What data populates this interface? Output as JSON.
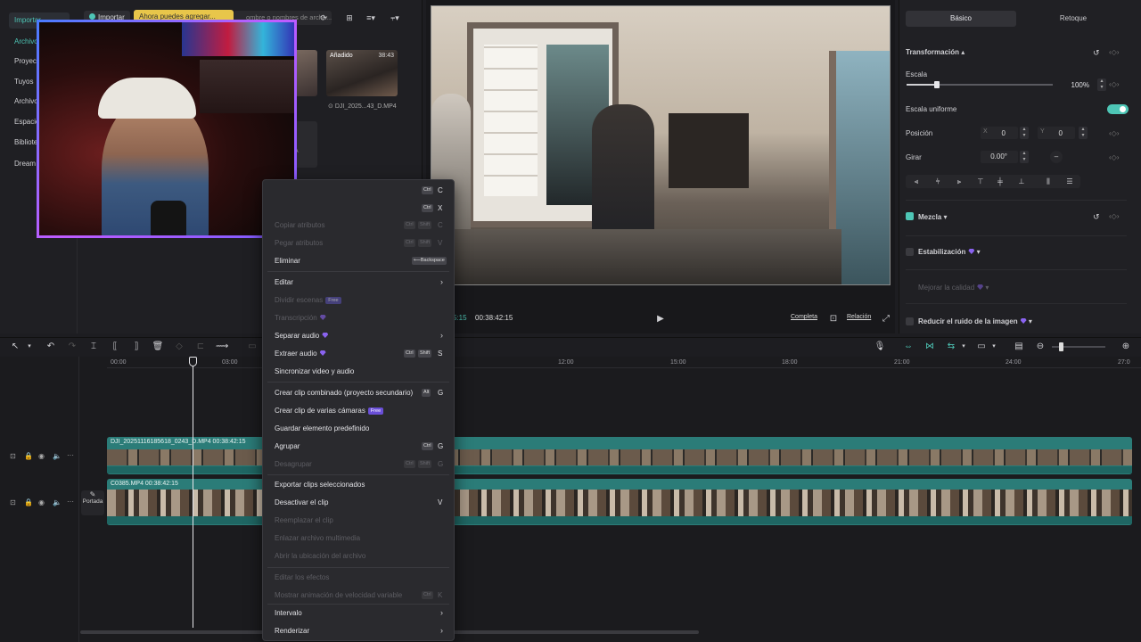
{
  "left_panel": {
    "sidebar": [
      "Importar",
      "Archivos",
      "Proyecto",
      "Tuyos",
      "Archivo",
      "Espacio",
      "Biblioteca",
      "Dream"
    ],
    "import_button": "Importar",
    "tooltip": "Ahora puedes agregar...",
    "search_placeholder": "ombre o nombres de archiv...",
    "media": [
      {
        "badge": "Añadido",
        "duration": "38:43",
        "name": "DJI_2025...43_D.MP4"
      }
    ],
    "partial_label": "A"
  },
  "preview": {
    "time_partial": "5:15",
    "timecode": "00:38:42:15",
    "quality": "Completa",
    "ratio": "Relación"
  },
  "props": {
    "tabs": [
      "Básico",
      "Retoque"
    ],
    "transform": "Transformación",
    "scale_label": "Escala",
    "scale_value": "100%",
    "uniform_label": "Escala uniforme",
    "position_label": "Posición",
    "pos_x_label": "X",
    "pos_x": "0",
    "pos_y_label": "Y",
    "pos_y": "0",
    "rotate_label": "Girar",
    "rotate_value": "0.00°",
    "blend_label": "Mezcla",
    "stabilize_label": "Estabilización",
    "quality_label": "Mejorar la calidad",
    "denoise_label": "Reducir el ruido de la imagen"
  },
  "timeline": {
    "ticks": [
      "00:00",
      "03:00",
      "12:00",
      "15:00",
      "18:00",
      "21:00",
      "24:00",
      "27:0"
    ],
    "clip1_title": "DJI_20251116185618_0243_D.MP4   00:38:42:15",
    "clip2_title": "C0385.MP4   00:38:42:15",
    "cover_label": "Portada"
  },
  "context_menu": {
    "items": [
      {
        "label": "",
        "keys": [
          "Ctrl"
        ],
        "letter": "C",
        "disabled": false
      },
      {
        "label": "",
        "keys": [
          "Ctrl"
        ],
        "letter": "X",
        "disabled": false
      },
      {
        "label": "Copiar atributos",
        "keys": [
          "Ctrl",
          "Shift"
        ],
        "letter": "C",
        "disabled": true
      },
      {
        "label": "Pegar atributos",
        "keys": [
          "Ctrl",
          "Shift"
        ],
        "letter": "V",
        "disabled": true
      },
      {
        "label": "Eliminar",
        "keys": [
          "Backspace"
        ],
        "letter": "",
        "disabled": false
      },
      {
        "label": "Editar",
        "arrow": true,
        "disabled": false
      },
      {
        "label": "Dividir escenas",
        "badge": "Free",
        "disabled": true
      },
      {
        "label": "Transcripción",
        "gem": true,
        "disabled": true
      },
      {
        "label": "Separar audio",
        "gem": true,
        "arrow": true,
        "disabled": false
      },
      {
        "label": "Extraer audio",
        "gem": true,
        "keys": [
          "Ctrl",
          "Shift"
        ],
        "letter": "S",
        "disabled": false
      },
      {
        "label": "Sincronizar video y audio",
        "disabled": false
      },
      {
        "label": "Crear clip combinado (proyecto secundario)",
        "keys": [
          "Alt"
        ],
        "letter": "G",
        "disabled": false
      },
      {
        "label": "Crear clip de varias cámaras",
        "badge": "Free",
        "disabled": false
      },
      {
        "label": "Guardar elemento predefinido",
        "disabled": false
      },
      {
        "label": "Agrupar",
        "keys": [
          "Ctrl"
        ],
        "letter": "G",
        "disabled": false
      },
      {
        "label": "Desagrupar",
        "keys": [
          "Ctrl",
          "Shift"
        ],
        "letter": "G",
        "disabled": true
      },
      {
        "label": "Exportar clips seleccionados",
        "disabled": false
      },
      {
        "label": "Desactivar el clip",
        "letter": "V",
        "disabled": false
      },
      {
        "label": "Reemplazar el clip",
        "disabled": true
      },
      {
        "label": "Enlazar archivo multimedia",
        "disabled": true
      },
      {
        "label": "Abrir la ubicación del archivo",
        "disabled": true
      },
      {
        "label": "Editar los efectos",
        "disabled": true
      },
      {
        "label": "Mostrar animación de velocidad variable",
        "keys": [
          "Ctrl"
        ],
        "letter": "K",
        "disabled": true
      },
      {
        "label": "Intervalo",
        "arrow": true,
        "disabled": false
      },
      {
        "label": "Renderizar",
        "arrow": true,
        "disabled": false
      }
    ]
  },
  "colors": {
    "accent": "#4ec6b6",
    "clip": "#2b7c78",
    "menu_bg": "#2a2a2e",
    "badge": "#6a4fd8"
  }
}
